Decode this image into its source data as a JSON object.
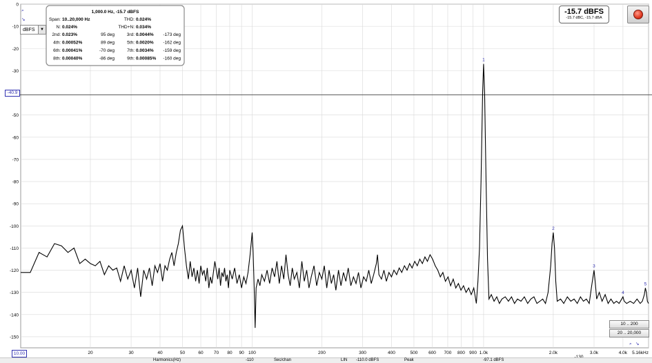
{
  "chart_data": {
    "type": "line",
    "title": "1,000.0 Hz, -15.7 dBFS",
    "xscale": "log",
    "xlim": [
      10,
      5160
    ],
    "ylim": [
      -155,
      0
    ],
    "x_ticks": [
      {
        "v": 20,
        "label": "20"
      },
      {
        "v": 30,
        "label": "30"
      },
      {
        "v": 40,
        "label": "40"
      },
      {
        "v": 50,
        "label": "50"
      },
      {
        "v": 60,
        "label": "60"
      },
      {
        "v": 70,
        "label": "70"
      },
      {
        "v": 80,
        "label": "80"
      },
      {
        "v": 90,
        "label": "90"
      },
      {
        "v": 100,
        "label": "100"
      },
      {
        "v": 200,
        "label": "200"
      },
      {
        "v": 300,
        "label": "300"
      },
      {
        "v": 400,
        "label": "400"
      },
      {
        "v": 500,
        "label": "500"
      },
      {
        "v": 600,
        "label": "600"
      },
      {
        "v": 700,
        "label": "700"
      },
      {
        "v": 800,
        "label": "800"
      },
      {
        "v": 900,
        "label": "900"
      },
      {
        "v": 1000,
        "label": "1.0k"
      },
      {
        "v": 2000,
        "label": "2.0k"
      },
      {
        "v": 3000,
        "label": "3.0k"
      },
      {
        "v": 4000,
        "label": "4.0k"
      },
      {
        "v": 5160,
        "label": "5.16kHz"
      }
    ],
    "y_ticks": [
      {
        "v": 0,
        "label": "0"
      },
      {
        "v": -10,
        "label": "-10"
      },
      {
        "v": -20,
        "label": "-20"
      },
      {
        "v": -30,
        "label": "-30"
      },
      {
        "v": -50,
        "label": "-50"
      },
      {
        "v": -60,
        "label": "-60"
      },
      {
        "v": -70,
        "label": "-70"
      },
      {
        "v": -80,
        "label": "-80"
      },
      {
        "v": -90,
        "label": "-90"
      },
      {
        "v": -100,
        "label": "-100"
      },
      {
        "v": -110,
        "label": "-110"
      },
      {
        "v": -120,
        "label": "-120"
      },
      {
        "v": -130,
        "label": "-130"
      },
      {
        "v": -140,
        "label": "-140"
      },
      {
        "v": -150,
        "label": "-150"
      }
    ],
    "cursor_level": -40.9,
    "harmonic_markers": [
      {
        "label": "1",
        "x": 1000,
        "y": -27
      },
      {
        "label": "2",
        "x": 2000,
        "y": -103
      },
      {
        "label": "3",
        "x": 3000,
        "y": -120
      },
      {
        "label": "4",
        "x": 4000,
        "y": -132
      },
      {
        "label": "5",
        "x": 5000,
        "y": -128
      }
    ],
    "series": [
      {
        "values_note": "",
        "points": [
          [
            10,
            -121
          ],
          [
            11,
            -121
          ],
          [
            12,
            -112
          ],
          [
            13,
            -114
          ],
          [
            14,
            -108
          ],
          [
            15,
            -109
          ],
          [
            16,
            -112
          ],
          [
            17,
            -110
          ],
          [
            18,
            -117
          ],
          [
            19,
            -115
          ],
          [
            20,
            -117
          ],
          [
            21,
            -118
          ],
          [
            22,
            -116
          ],
          [
            23,
            -122
          ],
          [
            24,
            -118
          ],
          [
            25,
            -120
          ],
          [
            26,
            -119
          ],
          [
            27,
            -125
          ],
          [
            28,
            -118
          ],
          [
            29,
            -124
          ],
          [
            30,
            -120
          ],
          [
            31,
            -128
          ],
          [
            32,
            -119
          ],
          [
            33,
            -132
          ],
          [
            34,
            -120
          ],
          [
            35,
            -124
          ],
          [
            36,
            -119
          ],
          [
            37,
            -127
          ],
          [
            38,
            -118
          ],
          [
            39,
            -121
          ],
          [
            40,
            -117
          ],
          [
            41,
            -125
          ],
          [
            42,
            -118
          ],
          [
            43,
            -120
          ],
          [
            44,
            -115
          ],
          [
            45,
            -112
          ],
          [
            46,
            -118
          ],
          [
            47,
            -112
          ],
          [
            48,
            -108
          ],
          [
            49,
            -102
          ],
          [
            50,
            -100
          ],
          [
            51,
            -110
          ],
          [
            52,
            -118
          ],
          [
            53,
            -124
          ],
          [
            54,
            -116
          ],
          [
            55,
            -123
          ],
          [
            56,
            -119
          ],
          [
            57,
            -125
          ],
          [
            58,
            -120
          ],
          [
            59,
            -126
          ],
          [
            60,
            -118
          ],
          [
            61,
            -122
          ],
          [
            62,
            -120
          ],
          [
            63,
            -125
          ],
          [
            64,
            -119
          ],
          [
            65,
            -128
          ],
          [
            66,
            -123
          ],
          [
            67,
            -126
          ],
          [
            68,
            -121
          ],
          [
            69,
            -116
          ],
          [
            70,
            -120
          ],
          [
            71,
            -124
          ],
          [
            72,
            -119
          ],
          [
            73,
            -127
          ],
          [
            74,
            -121
          ],
          [
            75,
            -123
          ],
          [
            76,
            -119
          ],
          [
            77,
            -125
          ],
          [
            78,
            -122
          ],
          [
            79,
            -128
          ],
          [
            80,
            -120
          ],
          [
            82,
            -124
          ],
          [
            84,
            -119
          ],
          [
            86,
            -126
          ],
          [
            88,
            -122
          ],
          [
            90,
            -128
          ],
          [
            92,
            -123
          ],
          [
            94,
            -126
          ],
          [
            96,
            -121
          ],
          [
            98,
            -113
          ],
          [
            99,
            -108
          ],
          [
            100,
            -103
          ],
          [
            101,
            -112
          ],
          [
            102,
            -128
          ],
          [
            103,
            -146
          ],
          [
            104,
            -128
          ],
          [
            106,
            -124
          ],
          [
            108,
            -127
          ],
          [
            110,
            -122
          ],
          [
            113,
            -125
          ],
          [
            116,
            -120
          ],
          [
            119,
            -126
          ],
          [
            122,
            -119
          ],
          [
            125,
            -123
          ],
          [
            128,
            -116
          ],
          [
            131,
            -126
          ],
          [
            134,
            -118
          ],
          [
            137,
            -124
          ],
          [
            140,
            -113
          ],
          [
            143,
            -122
          ],
          [
            146,
            -127
          ],
          [
            149,
            -119
          ],
          [
            152,
            -124
          ],
          [
            156,
            -121
          ],
          [
            160,
            -128
          ],
          [
            164,
            -116
          ],
          [
            168,
            -125
          ],
          [
            172,
            -120
          ],
          [
            176,
            -128
          ],
          [
            180,
            -123
          ],
          [
            185,
            -118
          ],
          [
            190,
            -127
          ],
          [
            195,
            -121
          ],
          [
            200,
            -124
          ],
          [
            205,
            -118
          ],
          [
            210,
            -128
          ],
          [
            215,
            -120
          ],
          [
            220,
            -126
          ],
          [
            225,
            -122
          ],
          [
            230,
            -129
          ],
          [
            236,
            -120
          ],
          [
            242,
            -127
          ],
          [
            248,
            -121
          ],
          [
            254,
            -125
          ],
          [
            260,
            -119
          ],
          [
            267,
            -127
          ],
          [
            274,
            -123
          ],
          [
            281,
            -126
          ],
          [
            288,
            -121
          ],
          [
            295,
            -128
          ],
          [
            303,
            -123
          ],
          [
            311,
            -125
          ],
          [
            319,
            -120
          ],
          [
            327,
            -126
          ],
          [
            335,
            -122
          ],
          [
            344,
            -117
          ],
          [
            348,
            -113
          ],
          [
            353,
            -122
          ],
          [
            362,
            -124
          ],
          [
            371,
            -120
          ],
          [
            380,
            -125
          ],
          [
            390,
            -121
          ],
          [
            400,
            -123
          ],
          [
            410,
            -120
          ],
          [
            421,
            -122
          ],
          [
            432,
            -119
          ],
          [
            443,
            -121
          ],
          [
            455,
            -118
          ],
          [
            467,
            -120
          ],
          [
            479,
            -117
          ],
          [
            491,
            -119
          ],
          [
            504,
            -116
          ],
          [
            517,
            -118
          ],
          [
            530,
            -115
          ],
          [
            544,
            -117
          ],
          [
            558,
            -114
          ],
          [
            572,
            -116
          ],
          [
            587,
            -113
          ],
          [
            602,
            -115
          ],
          [
            618,
            -118
          ],
          [
            634,
            -120
          ],
          [
            650,
            -123
          ],
          [
            667,
            -121
          ],
          [
            684,
            -125
          ],
          [
            702,
            -123
          ],
          [
            720,
            -127
          ],
          [
            739,
            -124
          ],
          [
            758,
            -128
          ],
          [
            778,
            -126
          ],
          [
            798,
            -129
          ],
          [
            819,
            -127
          ],
          [
            840,
            -130
          ],
          [
            862,
            -128
          ],
          [
            884,
            -131
          ],
          [
            907,
            -128
          ],
          [
            930,
            -135
          ],
          [
            945,
            -125
          ],
          [
            960,
            -110
          ],
          [
            975,
            -80
          ],
          [
            990,
            -40
          ],
          [
            1000,
            -27
          ],
          [
            1010,
            -40
          ],
          [
            1025,
            -80
          ],
          [
            1040,
            -115
          ],
          [
            1055,
            -133
          ],
          [
            1080,
            -131
          ],
          [
            1110,
            -134
          ],
          [
            1140,
            -132
          ],
          [
            1170,
            -135
          ],
          [
            1200,
            -133
          ],
          [
            1240,
            -132
          ],
          [
            1280,
            -134
          ],
          [
            1320,
            -132
          ],
          [
            1360,
            -135
          ],
          [
            1400,
            -133
          ],
          [
            1450,
            -134
          ],
          [
            1500,
            -132
          ],
          [
            1550,
            -135
          ],
          [
            1600,
            -133
          ],
          [
            1650,
            -132
          ],
          [
            1700,
            -135
          ],
          [
            1750,
            -134
          ],
          [
            1800,
            -133
          ],
          [
            1850,
            -135
          ],
          [
            1900,
            -130
          ],
          [
            1950,
            -118
          ],
          [
            1975,
            -108
          ],
          [
            2000,
            -103
          ],
          [
            2025,
            -110
          ],
          [
            2050,
            -125
          ],
          [
            2080,
            -134
          ],
          [
            2150,
            -133
          ],
          [
            2220,
            -135
          ],
          [
            2300,
            -132
          ],
          [
            2380,
            -134
          ],
          [
            2460,
            -133
          ],
          [
            2540,
            -135
          ],
          [
            2620,
            -132
          ],
          [
            2700,
            -134
          ],
          [
            2780,
            -133
          ],
          [
            2860,
            -135
          ],
          [
            2920,
            -128
          ],
          [
            2960,
            -124
          ],
          [
            3000,
            -120
          ],
          [
            3040,
            -126
          ],
          [
            3080,
            -133
          ],
          [
            3160,
            -130
          ],
          [
            3250,
            -134
          ],
          [
            3350,
            -131
          ],
          [
            3450,
            -135
          ],
          [
            3550,
            -133
          ],
          [
            3650,
            -135
          ],
          [
            3750,
            -134
          ],
          [
            3850,
            -135
          ],
          [
            3950,
            -133
          ],
          [
            4000,
            -132
          ],
          [
            4050,
            -134
          ],
          [
            4150,
            -135
          ],
          [
            4300,
            -134
          ],
          [
            4450,
            -135
          ],
          [
            4600,
            -133
          ],
          [
            4750,
            -135
          ],
          [
            4850,
            -134
          ],
          [
            4950,
            -131
          ],
          [
            5000,
            -128
          ],
          [
            5050,
            -130
          ],
          [
            5100,
            -134
          ],
          [
            5160,
            -135
          ]
        ]
      }
    ]
  },
  "panel": {
    "title": "1,000.0 Hz, -15.7 dBFS",
    "span_label": "Span:",
    "span_value": "10..20,000 Hz",
    "thd_label": "THD:",
    "thd_value": "0.024%",
    "n_label": "N:",
    "n_value": "0.024%",
    "thdn_label": "THD+N:",
    "thdn_value": "0.034%",
    "rows": [
      {
        "l1": "2nd:",
        "v1": "0.023%",
        "d1": "95 deg",
        "l2": "3rd:",
        "v2": "0.0044%",
        "d2": "-173 deg"
      },
      {
        "l1": "4th:",
        "v1": "0.00052%",
        "d1": "89 deg",
        "l2": "5th:",
        "v2": "0.0020%",
        "d2": "-162 deg"
      },
      {
        "l1": "6th:",
        "v1": "0.00041%",
        "d1": "-70 deg",
        "l2": "7th:",
        "v2": "0.0034%",
        "d2": "-159 deg"
      },
      {
        "l1": "8th:",
        "v1": "0.00040%",
        "d1": "-86 deg",
        "l2": "9th:",
        "v2": "0.00085%",
        "d2": "-160 deg"
      }
    ]
  },
  "controls": {
    "unit_select": "dBFS",
    "unit_arrow": "▼",
    "level_big": "-15.7 dBFS",
    "level_small": "-15.7 dBC, -15.7 dBA",
    "range_a": "10 .. 200",
    "range_b": "20 .. 20,000",
    "xmin_value": "10.00",
    "cursor_value": "-40.9",
    "ybottom_value": "-130",
    "zoom_icon": "⌕",
    "zoom_out_icon": "↘",
    "top_left_zero": "0"
  },
  "status_strip": {
    "item1": "Harmonics(Hz)",
    "item2": "-110",
    "item3": "Sec/chan",
    "item4": "LIN",
    "item5": "-110.0 dBFS",
    "item6": "Peak",
    "item7": "-97.1 dBFS"
  },
  "colors": {
    "trace": "#000000",
    "grid": "#d8d8d8",
    "cursor_line": "#555555",
    "label_blue": "#3030b0"
  }
}
